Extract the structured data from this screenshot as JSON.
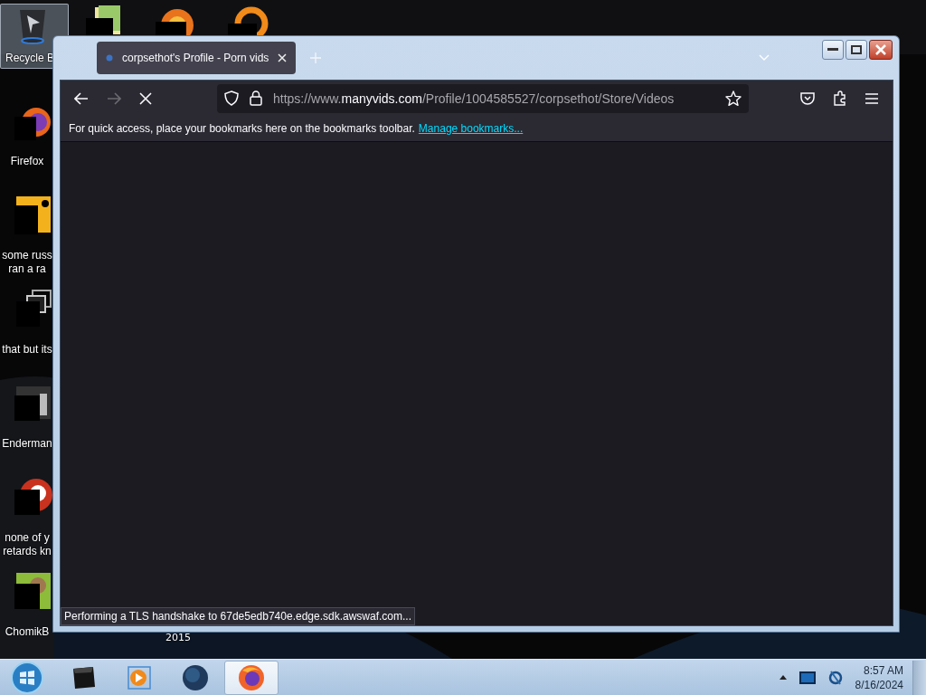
{
  "desktop_icons": [
    {
      "kind": "recycle-bin",
      "label": "Recycle B",
      "selected": true
    },
    {
      "kind": "firefox",
      "label": "Firefox",
      "selected": false
    },
    {
      "kind": "document",
      "label": "some russ\nran a ra",
      "selected": false
    },
    {
      "kind": "stack",
      "label": "that but its",
      "selected": false
    },
    {
      "kind": "terminal",
      "label": "Enderman",
      "selected": false
    },
    {
      "kind": "red-circle",
      "label": "none of y\nretards kn",
      "selected": false
    },
    {
      "kind": "hamster",
      "label": "ChomikB",
      "selected": false
    }
  ],
  "hidden_icon_label": "2015",
  "browser": {
    "tab": {
      "title": "corpsethot's Profile - Porn vids",
      "selected": true
    },
    "back": {
      "disabled": false
    },
    "forward": {
      "disabled": true
    },
    "loading": true,
    "url": "https://www.**manyvids.com**/Profile/1004585527/corpsethot/Store/Videos",
    "bookmarks_bar": {
      "message": "For quick access, place your bookmarks here on the bookmarks toolbar.",
      "link": "Manage bookmarks..."
    },
    "status": "Performing a TLS handshake to 67de5edb740e.edge.sdk.awswaf.com..."
  },
  "taskbar": {
    "items": [
      {
        "kind": "start",
        "selected": false
      },
      {
        "kind": "dark-box",
        "selected": false
      },
      {
        "kind": "media",
        "selected": false
      },
      {
        "kind": "globe",
        "selected": false
      },
      {
        "kind": "firefox",
        "selected": true
      }
    ],
    "time": "8:57 AM",
    "date": "8/16/2024"
  }
}
